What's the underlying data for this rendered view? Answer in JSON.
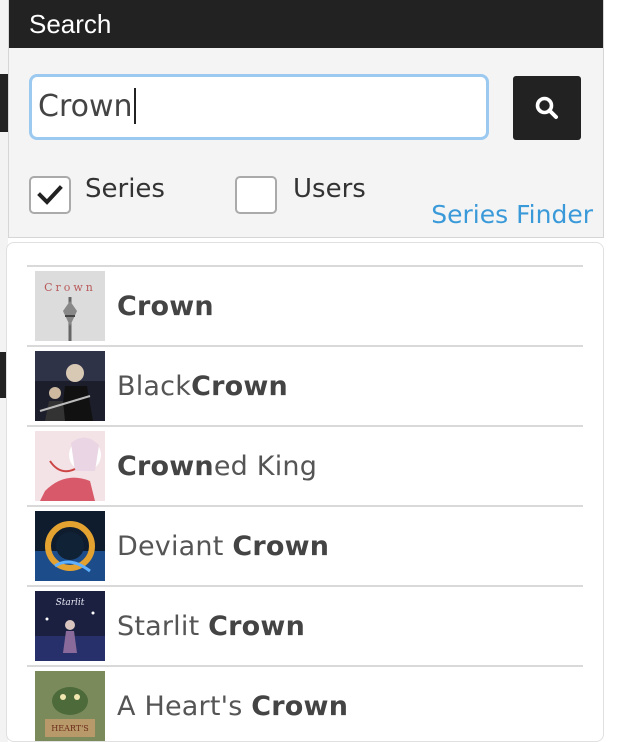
{
  "search": {
    "header": "Search",
    "query": "Crown",
    "series_label": "Series",
    "series_checked": true,
    "users_label": "Users",
    "users_checked": false,
    "series_finder_label": "Series Finder"
  },
  "results": [
    {
      "title_pre": "",
      "title_match": "Crown",
      "title_post": ""
    },
    {
      "title_pre": "Black",
      "title_match": "Crown",
      "title_post": ""
    },
    {
      "title_pre": "",
      "title_match": "Crown",
      "title_post": "ed King"
    },
    {
      "title_pre": "Deviant ",
      "title_match": "Crown",
      "title_post": ""
    },
    {
      "title_pre": "Starlit ",
      "title_match": "Crown",
      "title_post": ""
    },
    {
      "title_pre": "A Heart's ",
      "title_match": "Crown",
      "title_post": ""
    }
  ],
  "colors": {
    "header_bg": "#222222",
    "accent_link": "#3a9ad9",
    "input_focus": "#9cc9ef"
  }
}
